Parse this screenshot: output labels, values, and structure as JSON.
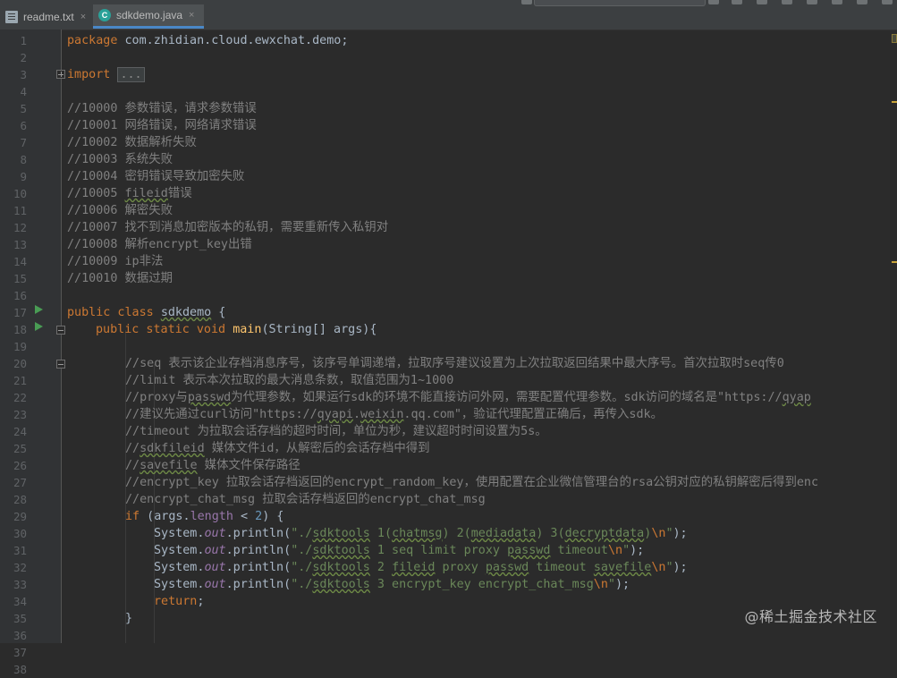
{
  "tabs": [
    {
      "label": "readme.txt",
      "icon": "text-file-icon",
      "close": "×"
    },
    {
      "label": "sdkdemo.java",
      "icon": "java-class-icon",
      "close": "×",
      "java_letter": "C"
    }
  ],
  "line_numbers": [
    "1",
    "2",
    "3",
    "4",
    "5",
    "6",
    "7",
    "8",
    "9",
    "10",
    "11",
    "12",
    "13",
    "14",
    "15",
    "16",
    "17",
    "18",
    "19",
    "20",
    "21",
    "22",
    "23",
    "24",
    "25",
    "26",
    "27",
    "28",
    "29",
    "30",
    "31",
    "32",
    "33",
    "34",
    "35",
    "36",
    "37",
    "38"
  ],
  "code": {
    "l1_kw": "package",
    "l1_rest": " com.zhidian.cloud.ewxchat.demo;",
    "l3_kw": "import",
    "l3_fold": "...",
    "l7": "//10000 参数错误，请求参数错误",
    "l8": "//10001 网络错误，网络请求错误",
    "l9": "//10002 数据解析失败",
    "l10": "//10003 系统失败",
    "l11": "//10004 密钥错误导致加密失败",
    "l12_a": "//10005 ",
    "l12_b": "fileid",
    "l12_c": "错误",
    "l13": "//10006 解密失败",
    "l14": "//10007 找不到消息加密版本的私钥，需要重新传入私钥对",
    "l15": "//10008 解析encrypt_key出错",
    "l16": "//10009 ip非法",
    "l17": "//10010 数据过期",
    "l19_kw": "public class ",
    "l19_name": "sdkdemo",
    "l19_rest": " {",
    "l20_kw": "public static void ",
    "l20_fn": "main",
    "l20_rest": "(String[] args){",
    "l22": "//seq 表示该企业存档消息序号，该序号单调递增，拉取序号建议设置为上次拉取返回结果中最大序号。首次拉取时seq传0",
    "l23": "//limit 表示本次拉取的最大消息条数，取值范围为1~1000",
    "l24_a": "//proxy与",
    "l24_b": "passwd",
    "l24_c": "为代理参数，如果运行sdk的环境不能直接访问外网，需要配置代理参数。sdk访问的域名是\"https://",
    "l24_d": "qyap",
    "l25_a": "//建议先通过curl访问\"https://",
    "l25_b": "qyapi",
    "l25_c": ".",
    "l25_d": "weixin",
    "l25_e": ".qq.com\"，验证代理配置正确后，再传入sdk。",
    "l26": "//timeout 为拉取会话存档的超时时间，单位为秒，建议超时时间设置为5s。",
    "l27_a": "//",
    "l27_b": "sdkfileid",
    "l27_c": " 媒体文件id，从解密后的会话存档中得到",
    "l28_a": "//",
    "l28_b": "savefile",
    "l28_c": " 媒体文件保存路径",
    "l29": "//encrypt_key 拉取会话存档返回的encrypt_random_key，使用配置在企业微信管理台的rsa公钥对应的私钥解密后得到enc",
    "l30": "//encrypt_chat_msg 拉取会话存档返回的encrypt_chat_msg",
    "l31_kw": "if",
    "l31_a": " (args.",
    "l31_prop": "length",
    "l31_b": " < ",
    "l31_num": "2",
    "l31_c": ") {",
    "sys": "System.",
    "out": "out",
    "println": ".println(",
    "l32_s1": "\"./",
    "l32_s2": "sdktools",
    "l32_s3": " 1(",
    "l32_s4": "chatmsg",
    "l32_s5": ") 2(",
    "l32_s6": "mediadata",
    "l32_s7": ") 3(",
    "l32_s8": "decryptdata",
    "l32_s9": ")",
    "esc_n": "\\n",
    "quote_end": "\"",
    "end": ");",
    "l33_s1": "\"./",
    "l33_s2": "sdktools",
    "l33_s3": " 1 seq limit proxy ",
    "l33_s4": "passwd",
    "l33_s5": " timeout",
    "l34_s1": "\"./",
    "l34_s2": "sdktools",
    "l34_s3": " 2 ",
    "l34_s4": "fileid",
    "l34_s5": " proxy ",
    "l34_s6": "passwd",
    "l34_s7": " timeout ",
    "l34_s8": "savefile",
    "l35_s1": "\"./",
    "l35_s2": "sdktools",
    "l35_s3": " 3 encrypt_key encrypt_chat_msg",
    "l36_kw": "return",
    "l36_rest": ";",
    "l37": "}"
  },
  "watermark": "@稀土掘金技术社区",
  "colors": {
    "background": "#2b2b2b",
    "keyword": "#cc7832",
    "comment": "#808080",
    "string": "#6a8759",
    "method": "#ffc66d",
    "field": "#9876aa",
    "number": "#6897bb"
  }
}
